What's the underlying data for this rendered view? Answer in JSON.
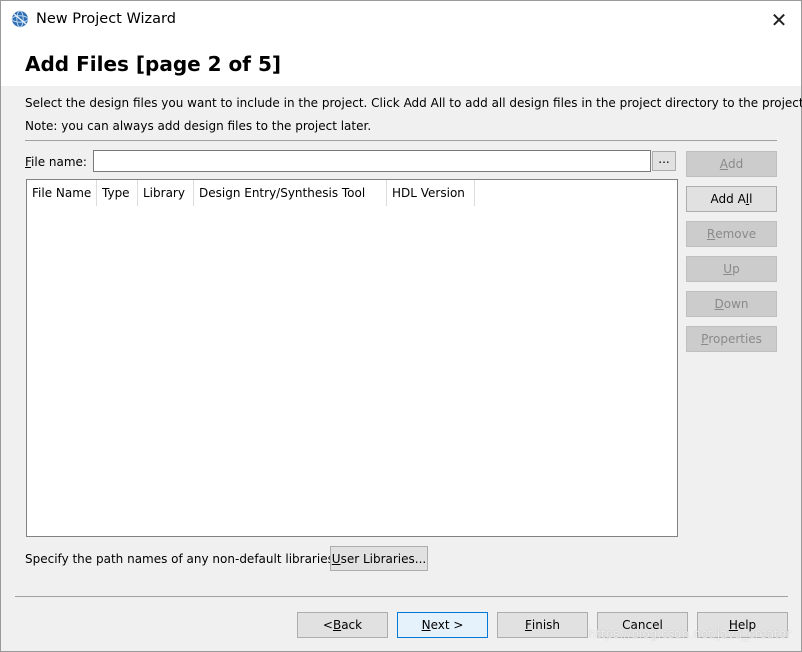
{
  "window": {
    "title": "New Project Wizard",
    "close_glyph": "✕",
    "icon": "quartus-globe-icon",
    "accent": "#0078d7"
  },
  "header": {
    "page_title": "Add Files [page 2 of 5]"
  },
  "description": {
    "line1": "Select the design files you want to include in the project. Click Add All to add all design files in the project directory to the project.",
    "line2": "Note: you can always add design files to the project later."
  },
  "file_name": {
    "label_prefix": "F",
    "label_rest": "ile name:",
    "value": "",
    "browse_label": "..."
  },
  "table": {
    "columns": [
      "File Name",
      "Type",
      "Library",
      "Design Entry/Synthesis Tool",
      "HDL Version"
    ],
    "rows": []
  },
  "side_buttons": {
    "add": {
      "u": "A",
      "rest": "dd",
      "pre": ""
    },
    "add_all": {
      "pre": "Add A",
      "u": "l",
      "rest": "l"
    },
    "remove": {
      "pre": "",
      "u": "R",
      "rest": "emove"
    },
    "up": {
      "pre": "",
      "u": "U",
      "rest": "p"
    },
    "down": {
      "pre": "",
      "u": "D",
      "rest": "own"
    },
    "properties": {
      "pre": "",
      "u": "P",
      "rest": "roperties"
    }
  },
  "libraries": {
    "text": "Specify the path names of any non-default libraries.",
    "button": {
      "pre": "",
      "u": "U",
      "rest": "ser Libraries..."
    }
  },
  "footer": {
    "back": {
      "pre": "< ",
      "u": "B",
      "rest": "ack"
    },
    "next": {
      "pre": "",
      "u": "N",
      "rest": "ext >"
    },
    "finish": {
      "pre": "",
      "u": "F",
      "rest": "inish"
    },
    "cancel": {
      "pre": "Cancel",
      "u": "",
      "rest": ""
    },
    "help": {
      "pre": "",
      "u": "H",
      "rest": "elp"
    }
  },
  "watermark": "https://blog.csdn.net/java_creater"
}
